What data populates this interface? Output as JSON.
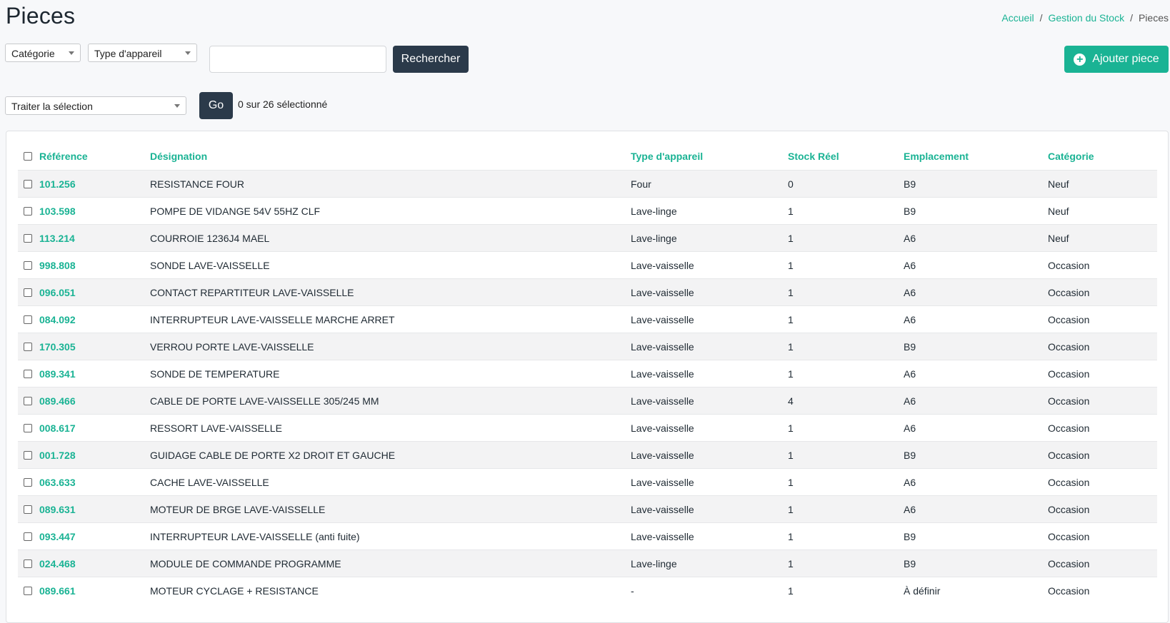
{
  "page": {
    "title": "Pieces"
  },
  "breadcrumb": {
    "items": [
      "Accueil",
      "Gestion du Stock",
      "Pieces"
    ],
    "separator": "/"
  },
  "filters": {
    "category_label": "Catégorie",
    "device_type_label": "Type d'appareil",
    "search_value": "",
    "search_button": "Rechercher"
  },
  "add_button": {
    "label": "Ajouter piece",
    "icon": "plus-circle-icon"
  },
  "bulk": {
    "action_label": "Traiter la sélection",
    "go_label": "Go",
    "selection_status": "0 sur 26 sélectionné"
  },
  "colors": {
    "accent": "#1ab394",
    "dark_button": "#2b3a4a",
    "row_stripe": "#f3f3f4"
  },
  "table": {
    "headers": {
      "reference": "Référence",
      "designation": "Désignation",
      "type": "Type d'appareil",
      "stock": "Stock Réel",
      "location": "Emplacement",
      "category": "Catégorie"
    },
    "rows": [
      {
        "ref": "101.256",
        "des": "RESISTANCE FOUR",
        "type": "Four",
        "stock": "0",
        "loc": "B9",
        "cat": "Neuf"
      },
      {
        "ref": "103.598",
        "des": "POMPE DE VIDANGE 54V 55HZ CLF",
        "type": "Lave-linge",
        "stock": "1",
        "loc": "B9",
        "cat": "Neuf"
      },
      {
        "ref": "113.214",
        "des": "COURROIE 1236J4 MAEL",
        "type": "Lave-linge",
        "stock": "1",
        "loc": "A6",
        "cat": "Neuf"
      },
      {
        "ref": "998.808",
        "des": "SONDE LAVE-VAISSELLE",
        "type": "Lave-vaisselle",
        "stock": "1",
        "loc": "A6",
        "cat": "Occasion"
      },
      {
        "ref": "096.051",
        "des": "CONTACT REPARTITEUR LAVE-VAISSELLE",
        "type": "Lave-vaisselle",
        "stock": "1",
        "loc": "A6",
        "cat": "Occasion"
      },
      {
        "ref": "084.092",
        "des": "INTERRUPTEUR LAVE-VAISSELLE MARCHE ARRET",
        "type": "Lave-vaisselle",
        "stock": "1",
        "loc": "A6",
        "cat": "Occasion"
      },
      {
        "ref": "170.305",
        "des": "VERROU PORTE LAVE-VAISSELLE",
        "type": "Lave-vaisselle",
        "stock": "1",
        "loc": "B9",
        "cat": "Occasion"
      },
      {
        "ref": "089.341",
        "des": "SONDE DE TEMPERATURE",
        "type": "Lave-vaisselle",
        "stock": "1",
        "loc": "A6",
        "cat": "Occasion"
      },
      {
        "ref": "089.466",
        "des": "CABLE DE PORTE LAVE-VAISSELLE 305/245 MM",
        "type": "Lave-vaisselle",
        "stock": "4",
        "loc": "A6",
        "cat": "Occasion"
      },
      {
        "ref": "008.617",
        "des": "RESSORT LAVE-VAISSELLE",
        "type": "Lave-vaisselle",
        "stock": "1",
        "loc": "A6",
        "cat": "Occasion"
      },
      {
        "ref": "001.728",
        "des": "GUIDAGE CABLE DE PORTE X2 DROIT ET GAUCHE",
        "type": "Lave-vaisselle",
        "stock": "1",
        "loc": "B9",
        "cat": "Occasion"
      },
      {
        "ref": "063.633",
        "des": "CACHE LAVE-VAISSELLE",
        "type": "Lave-vaisselle",
        "stock": "1",
        "loc": "A6",
        "cat": "Occasion"
      },
      {
        "ref": "089.631",
        "des": "MOTEUR DE BRGE LAVE-VAISSELLE",
        "type": "Lave-vaisselle",
        "stock": "1",
        "loc": "A6",
        "cat": "Occasion"
      },
      {
        "ref": "093.447",
        "des": "INTERRUPTEUR LAVE-VAISSELLE (anti fuite)",
        "type": "Lave-vaisselle",
        "stock": "1",
        "loc": "B9",
        "cat": "Occasion"
      },
      {
        "ref": "024.468",
        "des": "MODULE DE COMMANDE PROGRAMME",
        "type": "Lave-linge",
        "stock": "1",
        "loc": "B9",
        "cat": "Occasion"
      },
      {
        "ref": "089.661",
        "des": "MOTEUR CYCLAGE + RESISTANCE",
        "type": "-",
        "stock": "1",
        "loc": "À définir",
        "cat": "Occasion"
      }
    ]
  }
}
